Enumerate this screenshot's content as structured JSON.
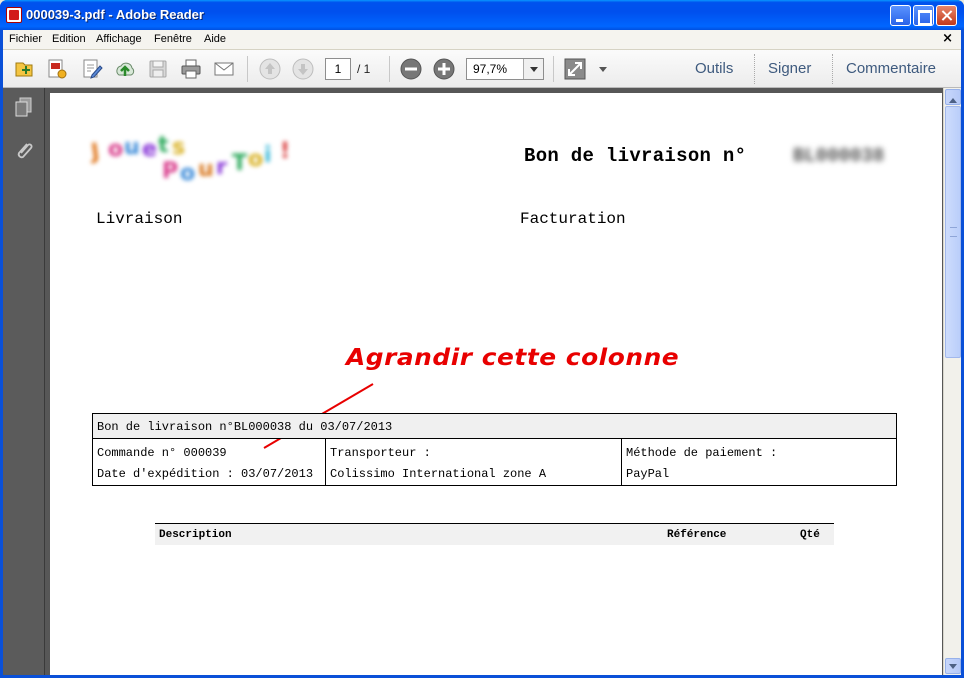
{
  "window": {
    "title": "000039-3.pdf - Adobe Reader"
  },
  "menubar": {
    "items": [
      "Fichier",
      "Edition",
      "Affichage",
      "Fenêtre",
      "Aide"
    ],
    "close_glyph": "×"
  },
  "toolbar": {
    "icons": [
      "open-icon",
      "create-pdf-icon",
      "edit-icon",
      "upload-icon",
      "save-icon",
      "print-icon",
      "email-icon",
      "previous-page-icon",
      "next-page-icon",
      "zoom-out-icon",
      "zoom-in-icon",
      "fit-page-icon",
      "menu-arrow-icon"
    ],
    "page_current": "1",
    "page_total": "/ 1",
    "zoom": "97,7%",
    "links": [
      "Outils",
      "Signer",
      "Commentaire"
    ]
  },
  "leftrail": {
    "icons": [
      "pages-panel-icon",
      "attachments-icon"
    ]
  },
  "document": {
    "title": "Bon de livraison n°",
    "number_blurred": "BL000038",
    "shipping_label": "Livraison",
    "billing_label": "Facturation",
    "info_header": "Bon de livraison n°BL000038 du 03/07/2013",
    "order_line": "Commande n° 000039",
    "ship_date_line": "Date d'expédition : 03/07/2013",
    "carrier_label": "Transporteur :",
    "carrier_value": "Colissimo International zone A",
    "payment_label": "Méthode de paiement :",
    "payment_value": "PayPal",
    "columns": [
      "Description",
      "Référence",
      "Qté"
    ]
  },
  "annotation": {
    "text": "Agrandir cette colonne",
    "color": "#e80000"
  },
  "colors": {
    "titlebar": "#0053ee",
    "doc_background": "#575757",
    "link_text": "#3e5a7e"
  }
}
